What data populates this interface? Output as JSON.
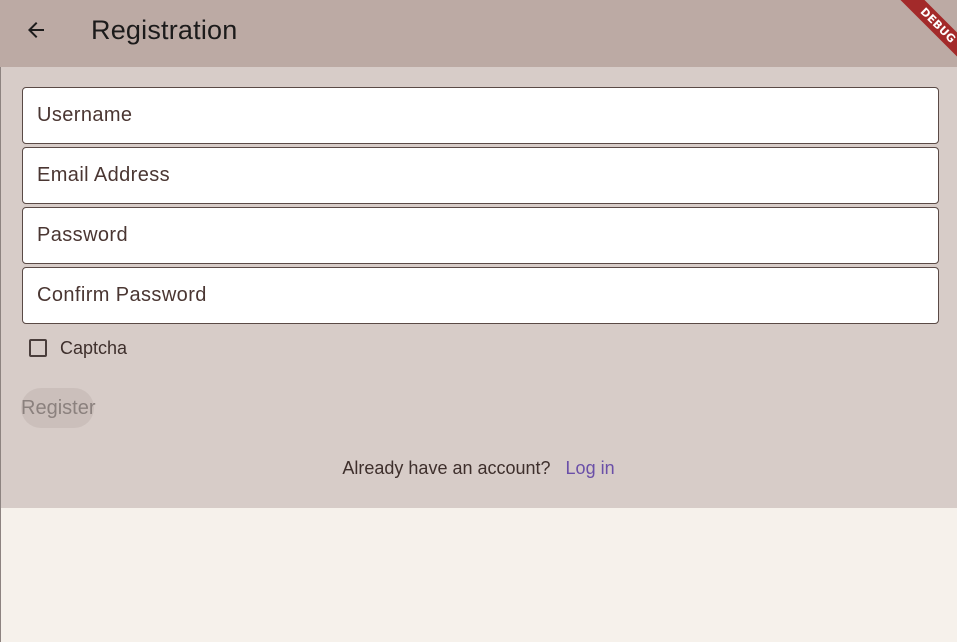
{
  "appbar": {
    "title": "Registration",
    "back_icon": "arrow-left-icon"
  },
  "debug_banner": {
    "label": "DEBUG",
    "color": "#a32a2a"
  },
  "form": {
    "fields": [
      {
        "placeholder": "Username",
        "value": ""
      },
      {
        "placeholder": "Email Address",
        "value": ""
      },
      {
        "placeholder": "Password",
        "value": ""
      },
      {
        "placeholder": "Confirm Password",
        "value": ""
      }
    ],
    "captcha": {
      "label": "Captcha",
      "checked": false
    },
    "register_label": "Register"
  },
  "footer": {
    "prompt": "Already have an account?",
    "login_label": "Log in"
  },
  "colors": {
    "appbar_bg": "#bcaaa4",
    "content_bg": "#d7ccc8",
    "page_bg": "#f6f1eb",
    "link": "#6a4fa8"
  }
}
